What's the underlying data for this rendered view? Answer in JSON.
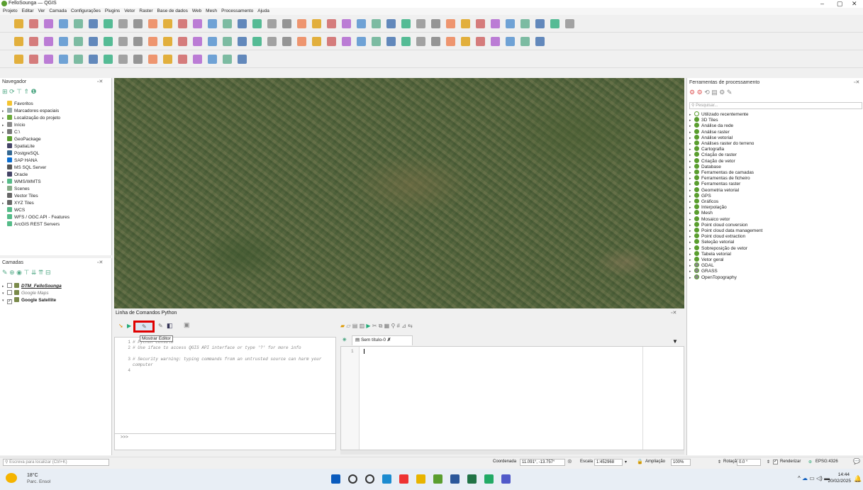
{
  "window": {
    "title": "FelloSounga — QGIS",
    "minimize": "–",
    "maximize": "▢",
    "close": "✕"
  },
  "menu": [
    "Projeto",
    "Editar",
    "Ver",
    "Camada",
    "Configurações",
    "Plugins",
    "Vetor",
    "Raster",
    "Base de dados",
    "Web",
    "Mesh",
    "Processamento",
    "Ajuda"
  ],
  "browser": {
    "title": "Navegador",
    "items": [
      {
        "label": "Favoritos",
        "color": "#f4c430",
        "arrow": ""
      },
      {
        "label": "Marcadores espaciais",
        "color": "#9aa",
        "arrow": "▸"
      },
      {
        "label": "Localização do projeto",
        "color": "#6aaa3a",
        "arrow": "▸"
      },
      {
        "label": "Início",
        "color": "#888",
        "arrow": "▸"
      },
      {
        "label": "C:\\",
        "color": "#777",
        "arrow": "▸"
      },
      {
        "label": "GeoPackage",
        "color": "#5a9e2f",
        "arrow": ""
      },
      {
        "label": "SpatiaLite",
        "color": "#446",
        "arrow": ""
      },
      {
        "label": "PostgreSQL",
        "color": "#336791",
        "arrow": ""
      },
      {
        "label": "SAP HANA",
        "color": "#0a6ed1",
        "arrow": ""
      },
      {
        "label": "MS SQL Server",
        "color": "#555",
        "arrow": ""
      },
      {
        "label": "Oracle",
        "color": "#446",
        "arrow": ""
      },
      {
        "label": "WMS/WMTS",
        "color": "#5b8",
        "arrow": "▸"
      },
      {
        "label": "Scenes",
        "color": "#8a8",
        "arrow": ""
      },
      {
        "label": "Vector Tiles",
        "color": "#666",
        "arrow": ""
      },
      {
        "label": "XYZ Tiles",
        "color": "#666",
        "arrow": "▸"
      },
      {
        "label": "WCS",
        "color": "#5b8",
        "arrow": ""
      },
      {
        "label": "WFS / OGC API - Features",
        "color": "#5b8",
        "arrow": ""
      },
      {
        "label": "ArcGIS REST Servers",
        "color": "#5b8",
        "arrow": ""
      }
    ]
  },
  "layers": {
    "title": "Camadas",
    "items": [
      {
        "label": "DTM_FelloSounga",
        "checked": false,
        "style": "bold-underline-italic",
        "arrow": "▸"
      },
      {
        "label": "Google Maps",
        "checked": false,
        "style": "italic-grey",
        "arrow": "▾"
      },
      {
        "label": "Google Satellite",
        "checked": true,
        "style": "bold",
        "arrow": "▾"
      }
    ]
  },
  "python": {
    "title": "Linha de Comandos Python",
    "tooltip": "Mostrar Editor",
    "lines": [
      {
        "n": "1",
        "text": "# Python Console"
      },
      {
        "n": "2",
        "text": "# Use iface to access QGIS API interface or type '?' for more info"
      },
      {
        "n": "3",
        "text": "# Security warning: typing commands from an untrusted source can harm your computer"
      },
      {
        "n": "4",
        "text": ""
      }
    ],
    "prompt": ">>>",
    "editor_tab": "Sem título-0",
    "editor_line": "1"
  },
  "processing": {
    "title": "Ferramentas de processamento",
    "search_placeholder": "Pesquisar...",
    "items": [
      {
        "label": "Utilizado recentemente",
        "icon": "clock-icon"
      },
      {
        "label": "3D Tiles",
        "icon": "qgis-icon"
      },
      {
        "label": "Análise da rede",
        "icon": "qgis-icon"
      },
      {
        "label": "Análise raster",
        "icon": "qgis-icon"
      },
      {
        "label": "Análise vetorial",
        "icon": "qgis-icon"
      },
      {
        "label": "Análises raster do terreno",
        "icon": "qgis-icon"
      },
      {
        "label": "Cartografia",
        "icon": "qgis-icon"
      },
      {
        "label": "Criação de raster",
        "icon": "qgis-icon"
      },
      {
        "label": "Criação de vetor",
        "icon": "qgis-icon"
      },
      {
        "label": "Database",
        "icon": "qgis-icon"
      },
      {
        "label": "Ferramentas de camadas",
        "icon": "qgis-icon"
      },
      {
        "label": "Ferramentas de ficheiro",
        "icon": "qgis-icon"
      },
      {
        "label": "Ferramentas raster",
        "icon": "qgis-icon"
      },
      {
        "label": "Geometria vetorial",
        "icon": "qgis-icon"
      },
      {
        "label": "GPS",
        "icon": "qgis-icon"
      },
      {
        "label": "Gráficos",
        "icon": "qgis-icon"
      },
      {
        "label": "Interpolação",
        "icon": "qgis-icon"
      },
      {
        "label": "Mesh",
        "icon": "qgis-icon"
      },
      {
        "label": "Mosaico vetor",
        "icon": "qgis-icon"
      },
      {
        "label": "Point cloud conversion",
        "icon": "qgis-icon"
      },
      {
        "label": "Point cloud data management",
        "icon": "qgis-icon"
      },
      {
        "label": "Point cloud extraction",
        "icon": "qgis-icon"
      },
      {
        "label": "Seleção vetorial",
        "icon": "qgis-icon"
      },
      {
        "label": "Sobreposição de vetor",
        "icon": "qgis-icon"
      },
      {
        "label": "Tabela vetorial",
        "icon": "qgis-icon"
      },
      {
        "label": "Vetor geral",
        "icon": "qgis-icon"
      },
      {
        "label": "GDAL",
        "icon": "gdal-icon"
      },
      {
        "label": "GRASS",
        "icon": "grass-icon"
      },
      {
        "label": "OpenTopography",
        "icon": "opentopo-icon"
      }
    ]
  },
  "status": {
    "locator_placeholder": "Escreva para localizar (Ctrl+K)",
    "coord_label": "Coordenada",
    "coord_value": "11.091°, -13.757°",
    "scale_label": "Escala",
    "scale_value": "1:452968",
    "magnify_label": "Ampliação",
    "magnify_value": "100%",
    "rotation_label": "Rotação",
    "rotation_value": "0.0 °",
    "render_label": "Renderizar",
    "crs": "EPSG:4326"
  },
  "taskbar": {
    "temp": "18°C",
    "weather": "Parc. Ensol",
    "time": "14:44",
    "date": "20/02/2025"
  }
}
